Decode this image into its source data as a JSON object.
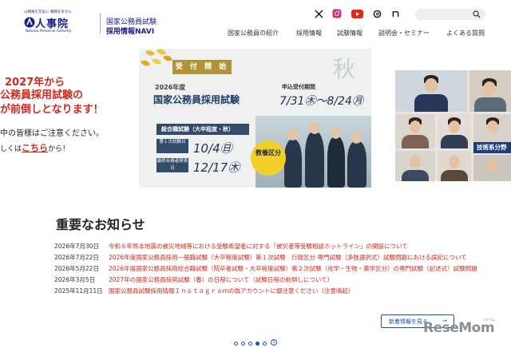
{
  "header": {
    "logo": {
      "tagline": "公務員を元気に 職務を幸せに",
      "org_name": "人事院",
      "org_name_en": "National Personnel Authority",
      "navi_line1": "国家公務員試験",
      "navi_line2": "採用情報NAVI"
    },
    "social_icons": [
      "x-icon",
      "instagram-icon",
      "youtube-icon",
      "threads-icon",
      "note-icon"
    ],
    "search": {
      "placeholder": ""
    },
    "nav": [
      {
        "label": "国家公務員の紹介"
      },
      {
        "label": "採用情報"
      },
      {
        "label": "試験情報"
      },
      {
        "label": "説明会・セミナー"
      },
      {
        "label": "よくある質問"
      }
    ]
  },
  "hero": {
    "left_text": {
      "line1": "2027年から",
      "line2": "公務員採用試験の",
      "line3": "が前倒しとなります！",
      "line4": "中の皆様はご注意ください。",
      "line5_prefix": "しくは",
      "line5_link": "こちら",
      "line5_suffix": "から！"
    },
    "banner": {
      "uketsuke": "受 付 開 始",
      "year": "2026年度",
      "exam_title": "国家公務員採用試験",
      "period_label": "申込受付期間",
      "period": "7/31㊍〜8/24㊊",
      "season": "秋",
      "sogo": "総合職試験（大卒程度・秋）",
      "first_exam_label": "第１次試験日",
      "first_exam_date": "10/4㊐",
      "final_label": "最終合格者発表日",
      "final_date": "12/17㊍",
      "kyoyo": "教養区分"
    },
    "side_photo": {
      "badge": "技術系分野"
    }
  },
  "news": {
    "title": "重要なお知らせ",
    "items": [
      {
        "date": "2026年7月30日",
        "text": "令和８年熊本地震の被災地域等における受験希望者に対する「被災者等受験相談ホットライン」の開設について"
      },
      {
        "date": "2026年7月22日",
        "text": "2026年度国家公務員採用一般職試験（大卒程度試験）第１次試験　行政区分 専門試験（多肢選択式）試験問題における誤記について"
      },
      {
        "date": "2026年5月22日",
        "text": "2026年度国家公務員採用総合職試験（院卒者試験・大卒程度試験）第２次試験（化学・生物・薬学区分）の専門試験（記述式）試験問題"
      },
      {
        "date": "2026年3月5日",
        "text": "2027年の国家公務員採用試験（春）の日程について（試験日程の前倒しについて）"
      },
      {
        "date": "2025年11月11日",
        "text": "国家公務員試験採用情報Ｉｎｓｔａｇｒａｍの偽アカウントに御注意ください（注意喚起）"
      }
    ],
    "more_label": "新着情報を見る",
    "more_arrow": "→"
  },
  "carousel": {
    "slides": 5,
    "active_index": 3,
    "pause_symbol": "II"
  },
  "watermark": {
    "text": "ReseMom",
    "small": "リセマム"
  },
  "colors": {
    "brand": "#1d2088",
    "accent_red": "#d0281e",
    "link_blue": "#1d4fa5"
  }
}
